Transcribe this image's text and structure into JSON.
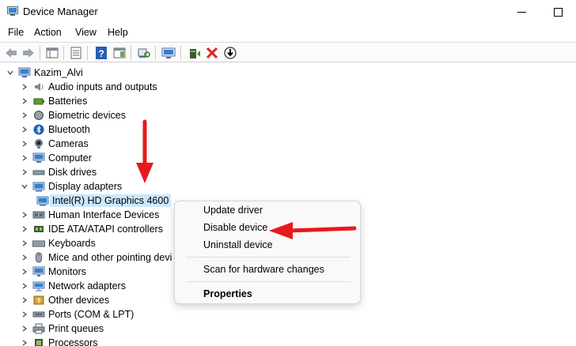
{
  "window": {
    "title": "Device Manager"
  },
  "menu": {
    "file": "File",
    "action": "Action",
    "view": "View",
    "help": "Help"
  },
  "toolbar": {
    "icons": [
      "back-arrow-icon",
      "forward-arrow-icon",
      "properties-view-icon",
      "list-view-icon",
      "help-icon",
      "action-pane-icon",
      "scan-hardware-icon",
      "monitor-icon",
      "update-driver-icon",
      "uninstall-x-icon",
      "disable-device-icon"
    ]
  },
  "tree": {
    "root": "Kazim_Alvi",
    "items": [
      {
        "label": "Audio inputs and outputs",
        "icon": "speaker-icon"
      },
      {
        "label": "Batteries",
        "icon": "battery-icon"
      },
      {
        "label": "Biometric devices",
        "icon": "fingerprint-icon"
      },
      {
        "label": "Bluetooth",
        "icon": "bluetooth-icon"
      },
      {
        "label": "Cameras",
        "icon": "camera-icon"
      },
      {
        "label": "Computer",
        "icon": "computer-icon"
      },
      {
        "label": "Disk drives",
        "icon": "disk-drive-icon"
      },
      {
        "label": "Display adapters",
        "icon": "display-adapter-icon",
        "expanded": true
      },
      {
        "label": "Intel(R) HD Graphics 4600",
        "icon": "display-adapter-icon",
        "child": true,
        "selected": true
      },
      {
        "label": "Human Interface Devices",
        "icon": "hid-icon"
      },
      {
        "label": "IDE ATA/ATAPI controllers",
        "icon": "ide-controller-icon"
      },
      {
        "label": "Keyboards",
        "icon": "keyboard-icon"
      },
      {
        "label": "Mice and other pointing devi",
        "icon": "mouse-icon"
      },
      {
        "label": "Monitors",
        "icon": "monitor-icon"
      },
      {
        "label": "Network adapters",
        "icon": "network-adapter-icon"
      },
      {
        "label": "Other devices",
        "icon": "other-devices-icon"
      },
      {
        "label": "Ports (COM & LPT)",
        "icon": "port-icon"
      },
      {
        "label": "Print queues",
        "icon": "printer-icon"
      },
      {
        "label": "Processors",
        "icon": "processor-icon"
      }
    ]
  },
  "context_menu": {
    "update_driver": "Update driver",
    "disable_device": "Disable device",
    "uninstall_device": "Uninstall device",
    "scan": "Scan for hardware changes",
    "properties": "Properties"
  },
  "colors": {
    "selection": "#cce8ff",
    "annotation_arrow": "#e8191b"
  }
}
